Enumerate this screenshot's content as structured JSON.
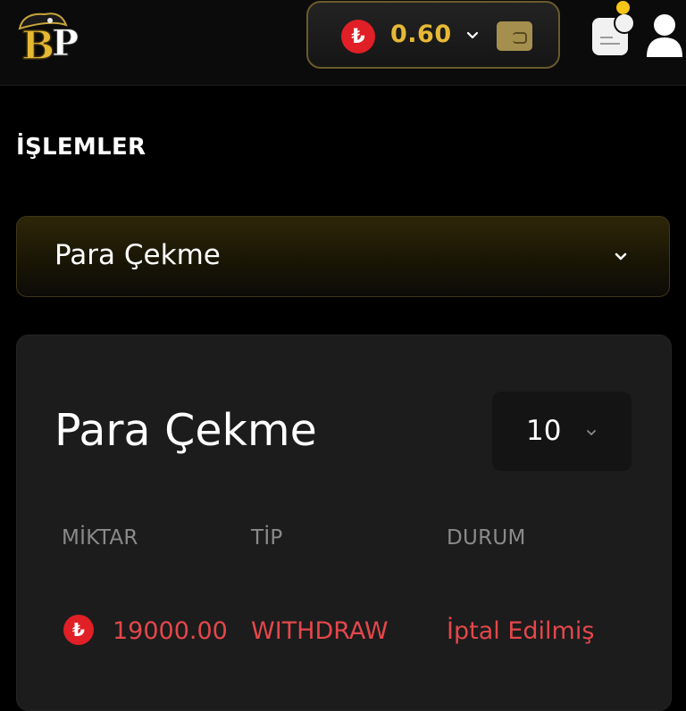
{
  "header": {
    "logo_text": "BP",
    "currency_symbol": "₺",
    "balance": "0.60",
    "colors": {
      "accent_gold": "#e6b935",
      "currency_red": "#e01f26",
      "notification": "#f5c518"
    },
    "icons": [
      "chevron-down-icon",
      "wallet-icon",
      "message-icon",
      "user-icon"
    ]
  },
  "page": {
    "section_title": "İŞLEMLER"
  },
  "transaction_type_select": {
    "selected": "Para Çekme"
  },
  "card": {
    "title": "Para Çekme",
    "page_size": "10",
    "columns": [
      "MİKTAR",
      "TİP",
      "DURUM"
    ],
    "rows": [
      {
        "currency_symbol": "₺",
        "amount": "19000.00",
        "type": "WITHDRAW",
        "status": "İptal Edilmiş"
      }
    ]
  }
}
